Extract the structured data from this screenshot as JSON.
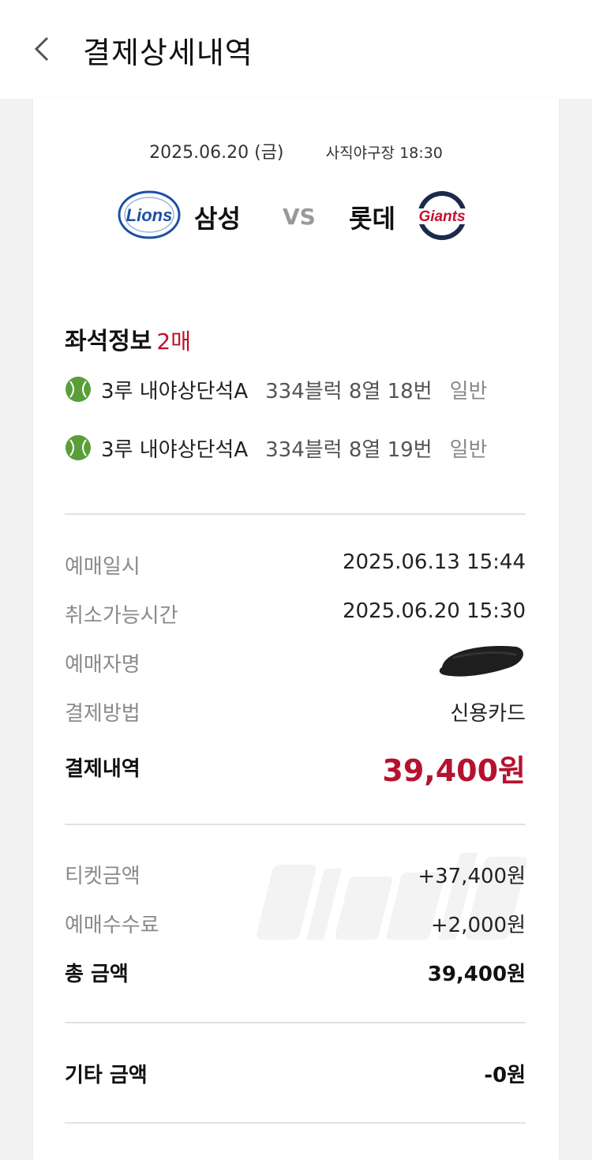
{
  "header": {
    "title": "결제상세내역"
  },
  "game": {
    "date": "2025.06.20 (금)",
    "venue_time": "사직야구장 18:30",
    "away_team": "삼성",
    "home_team": "롯데",
    "vs": "VS",
    "away_logo_text": "Lions",
    "home_logo_text": "Giants"
  },
  "seats": {
    "title": "좌석정보",
    "count": "2매",
    "items": [
      {
        "zone": "3루 내야상단석A",
        "position": "334블럭 8열 18번",
        "grade": "일반"
      },
      {
        "zone": "3루 내야상단석A",
        "position": "334블럭 8열 19번",
        "grade": "일반"
      }
    ]
  },
  "booking": {
    "date_label": "예매일시",
    "date_value": "2025.06.13 15:44",
    "cancel_label": "취소가능시간",
    "cancel_value": "2025.06.20 15:30",
    "name_label": "예매자명",
    "method_label": "결제방법",
    "method_value": "신용카드",
    "total_label": "결제내역",
    "total_value": "39,400원"
  },
  "breakdown": {
    "ticket_label": "티켓금액",
    "ticket_value": "+37,400원",
    "fee_label": "예매수수료",
    "fee_value": "+2,000원",
    "sum_label": "총 금액",
    "sum_value": "39,400원"
  },
  "other": {
    "label": "기타 금액",
    "value": "-0원"
  },
  "colors": {
    "accent_red": "#b5122e",
    "ball_green": "#5a9e3a"
  }
}
